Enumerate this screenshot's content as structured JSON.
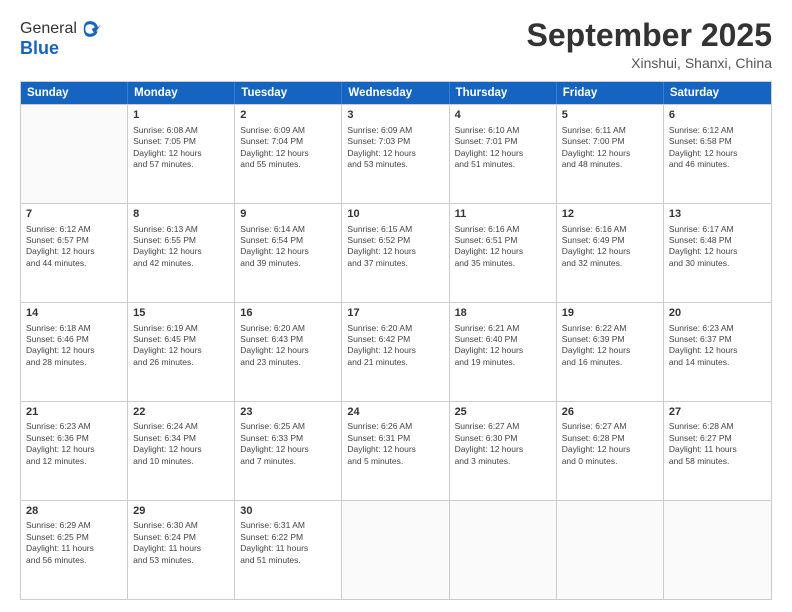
{
  "header": {
    "logo_general": "General",
    "logo_blue": "Blue",
    "month_title": "September 2025",
    "location": "Xinshui, Shanxi, China"
  },
  "days_of_week": [
    "Sunday",
    "Monday",
    "Tuesday",
    "Wednesday",
    "Thursday",
    "Friday",
    "Saturday"
  ],
  "weeks": [
    [
      {
        "day": "",
        "lines": []
      },
      {
        "day": "1",
        "lines": [
          "Sunrise: 6:08 AM",
          "Sunset: 7:05 PM",
          "Daylight: 12 hours",
          "and 57 minutes."
        ]
      },
      {
        "day": "2",
        "lines": [
          "Sunrise: 6:09 AM",
          "Sunset: 7:04 PM",
          "Daylight: 12 hours",
          "and 55 minutes."
        ]
      },
      {
        "day": "3",
        "lines": [
          "Sunrise: 6:09 AM",
          "Sunset: 7:03 PM",
          "Daylight: 12 hours",
          "and 53 minutes."
        ]
      },
      {
        "day": "4",
        "lines": [
          "Sunrise: 6:10 AM",
          "Sunset: 7:01 PM",
          "Daylight: 12 hours",
          "and 51 minutes."
        ]
      },
      {
        "day": "5",
        "lines": [
          "Sunrise: 6:11 AM",
          "Sunset: 7:00 PM",
          "Daylight: 12 hours",
          "and 48 minutes."
        ]
      },
      {
        "day": "6",
        "lines": [
          "Sunrise: 6:12 AM",
          "Sunset: 6:58 PM",
          "Daylight: 12 hours",
          "and 46 minutes."
        ]
      }
    ],
    [
      {
        "day": "7",
        "lines": [
          "Sunrise: 6:12 AM",
          "Sunset: 6:57 PM",
          "Daylight: 12 hours",
          "and 44 minutes."
        ]
      },
      {
        "day": "8",
        "lines": [
          "Sunrise: 6:13 AM",
          "Sunset: 6:55 PM",
          "Daylight: 12 hours",
          "and 42 minutes."
        ]
      },
      {
        "day": "9",
        "lines": [
          "Sunrise: 6:14 AM",
          "Sunset: 6:54 PM",
          "Daylight: 12 hours",
          "and 39 minutes."
        ]
      },
      {
        "day": "10",
        "lines": [
          "Sunrise: 6:15 AM",
          "Sunset: 6:52 PM",
          "Daylight: 12 hours",
          "and 37 minutes."
        ]
      },
      {
        "day": "11",
        "lines": [
          "Sunrise: 6:16 AM",
          "Sunset: 6:51 PM",
          "Daylight: 12 hours",
          "and 35 minutes."
        ]
      },
      {
        "day": "12",
        "lines": [
          "Sunrise: 6:16 AM",
          "Sunset: 6:49 PM",
          "Daylight: 12 hours",
          "and 32 minutes."
        ]
      },
      {
        "day": "13",
        "lines": [
          "Sunrise: 6:17 AM",
          "Sunset: 6:48 PM",
          "Daylight: 12 hours",
          "and 30 minutes."
        ]
      }
    ],
    [
      {
        "day": "14",
        "lines": [
          "Sunrise: 6:18 AM",
          "Sunset: 6:46 PM",
          "Daylight: 12 hours",
          "and 28 minutes."
        ]
      },
      {
        "day": "15",
        "lines": [
          "Sunrise: 6:19 AM",
          "Sunset: 6:45 PM",
          "Daylight: 12 hours",
          "and 26 minutes."
        ]
      },
      {
        "day": "16",
        "lines": [
          "Sunrise: 6:20 AM",
          "Sunset: 6:43 PM",
          "Daylight: 12 hours",
          "and 23 minutes."
        ]
      },
      {
        "day": "17",
        "lines": [
          "Sunrise: 6:20 AM",
          "Sunset: 6:42 PM",
          "Daylight: 12 hours",
          "and 21 minutes."
        ]
      },
      {
        "day": "18",
        "lines": [
          "Sunrise: 6:21 AM",
          "Sunset: 6:40 PM",
          "Daylight: 12 hours",
          "and 19 minutes."
        ]
      },
      {
        "day": "19",
        "lines": [
          "Sunrise: 6:22 AM",
          "Sunset: 6:39 PM",
          "Daylight: 12 hours",
          "and 16 minutes."
        ]
      },
      {
        "day": "20",
        "lines": [
          "Sunrise: 6:23 AM",
          "Sunset: 6:37 PM",
          "Daylight: 12 hours",
          "and 14 minutes."
        ]
      }
    ],
    [
      {
        "day": "21",
        "lines": [
          "Sunrise: 6:23 AM",
          "Sunset: 6:36 PM",
          "Daylight: 12 hours",
          "and 12 minutes."
        ]
      },
      {
        "day": "22",
        "lines": [
          "Sunrise: 6:24 AM",
          "Sunset: 6:34 PM",
          "Daylight: 12 hours",
          "and 10 minutes."
        ]
      },
      {
        "day": "23",
        "lines": [
          "Sunrise: 6:25 AM",
          "Sunset: 6:33 PM",
          "Daylight: 12 hours",
          "and 7 minutes."
        ]
      },
      {
        "day": "24",
        "lines": [
          "Sunrise: 6:26 AM",
          "Sunset: 6:31 PM",
          "Daylight: 12 hours",
          "and 5 minutes."
        ]
      },
      {
        "day": "25",
        "lines": [
          "Sunrise: 6:27 AM",
          "Sunset: 6:30 PM",
          "Daylight: 12 hours",
          "and 3 minutes."
        ]
      },
      {
        "day": "26",
        "lines": [
          "Sunrise: 6:27 AM",
          "Sunset: 6:28 PM",
          "Daylight: 12 hours",
          "and 0 minutes."
        ]
      },
      {
        "day": "27",
        "lines": [
          "Sunrise: 6:28 AM",
          "Sunset: 6:27 PM",
          "Daylight: 11 hours",
          "and 58 minutes."
        ]
      }
    ],
    [
      {
        "day": "28",
        "lines": [
          "Sunrise: 6:29 AM",
          "Sunset: 6:25 PM",
          "Daylight: 11 hours",
          "and 56 minutes."
        ]
      },
      {
        "day": "29",
        "lines": [
          "Sunrise: 6:30 AM",
          "Sunset: 6:24 PM",
          "Daylight: 11 hours",
          "and 53 minutes."
        ]
      },
      {
        "day": "30",
        "lines": [
          "Sunrise: 6:31 AM",
          "Sunset: 6:22 PM",
          "Daylight: 11 hours",
          "and 51 minutes."
        ]
      },
      {
        "day": "",
        "lines": []
      },
      {
        "day": "",
        "lines": []
      },
      {
        "day": "",
        "lines": []
      },
      {
        "day": "",
        "lines": []
      }
    ]
  ]
}
